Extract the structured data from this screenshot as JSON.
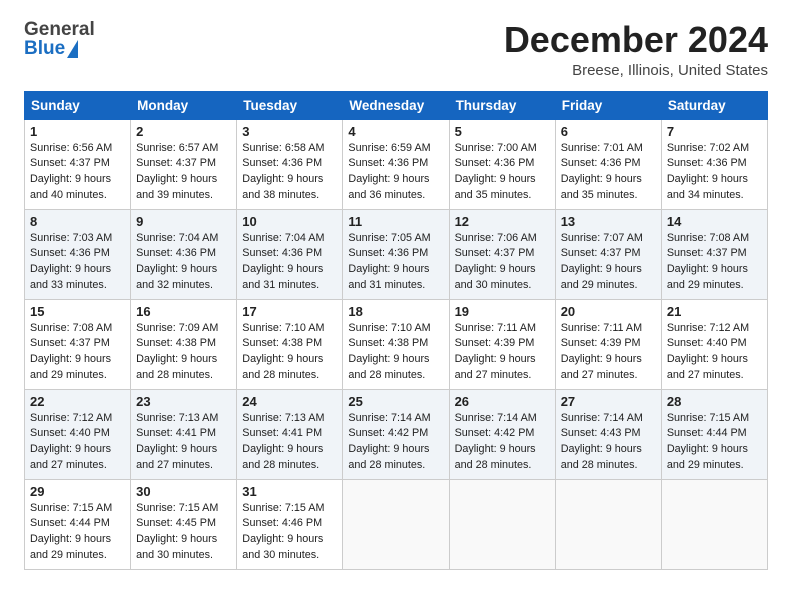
{
  "header": {
    "logo_general": "General",
    "logo_blue": "Blue",
    "month": "December 2024",
    "location": "Breese, Illinois, United States"
  },
  "weekdays": [
    "Sunday",
    "Monday",
    "Tuesday",
    "Wednesday",
    "Thursday",
    "Friday",
    "Saturday"
  ],
  "weeks": [
    [
      {
        "day": "1",
        "sunrise": "Sunrise: 6:56 AM",
        "sunset": "Sunset: 4:37 PM",
        "daylight": "Daylight: 9 hours and 40 minutes."
      },
      {
        "day": "2",
        "sunrise": "Sunrise: 6:57 AM",
        "sunset": "Sunset: 4:37 PM",
        "daylight": "Daylight: 9 hours and 39 minutes."
      },
      {
        "day": "3",
        "sunrise": "Sunrise: 6:58 AM",
        "sunset": "Sunset: 4:36 PM",
        "daylight": "Daylight: 9 hours and 38 minutes."
      },
      {
        "day": "4",
        "sunrise": "Sunrise: 6:59 AM",
        "sunset": "Sunset: 4:36 PM",
        "daylight": "Daylight: 9 hours and 36 minutes."
      },
      {
        "day": "5",
        "sunrise": "Sunrise: 7:00 AM",
        "sunset": "Sunset: 4:36 PM",
        "daylight": "Daylight: 9 hours and 35 minutes."
      },
      {
        "day": "6",
        "sunrise": "Sunrise: 7:01 AM",
        "sunset": "Sunset: 4:36 PM",
        "daylight": "Daylight: 9 hours and 35 minutes."
      },
      {
        "day": "7",
        "sunrise": "Sunrise: 7:02 AM",
        "sunset": "Sunset: 4:36 PM",
        "daylight": "Daylight: 9 hours and 34 minutes."
      }
    ],
    [
      {
        "day": "8",
        "sunrise": "Sunrise: 7:03 AM",
        "sunset": "Sunset: 4:36 PM",
        "daylight": "Daylight: 9 hours and 33 minutes."
      },
      {
        "day": "9",
        "sunrise": "Sunrise: 7:04 AM",
        "sunset": "Sunset: 4:36 PM",
        "daylight": "Daylight: 9 hours and 32 minutes."
      },
      {
        "day": "10",
        "sunrise": "Sunrise: 7:04 AM",
        "sunset": "Sunset: 4:36 PM",
        "daylight": "Daylight: 9 hours and 31 minutes."
      },
      {
        "day": "11",
        "sunrise": "Sunrise: 7:05 AM",
        "sunset": "Sunset: 4:36 PM",
        "daylight": "Daylight: 9 hours and 31 minutes."
      },
      {
        "day": "12",
        "sunrise": "Sunrise: 7:06 AM",
        "sunset": "Sunset: 4:37 PM",
        "daylight": "Daylight: 9 hours and 30 minutes."
      },
      {
        "day": "13",
        "sunrise": "Sunrise: 7:07 AM",
        "sunset": "Sunset: 4:37 PM",
        "daylight": "Daylight: 9 hours and 29 minutes."
      },
      {
        "day": "14",
        "sunrise": "Sunrise: 7:08 AM",
        "sunset": "Sunset: 4:37 PM",
        "daylight": "Daylight: 9 hours and 29 minutes."
      }
    ],
    [
      {
        "day": "15",
        "sunrise": "Sunrise: 7:08 AM",
        "sunset": "Sunset: 4:37 PM",
        "daylight": "Daylight: 9 hours and 29 minutes."
      },
      {
        "day": "16",
        "sunrise": "Sunrise: 7:09 AM",
        "sunset": "Sunset: 4:38 PM",
        "daylight": "Daylight: 9 hours and 28 minutes."
      },
      {
        "day": "17",
        "sunrise": "Sunrise: 7:10 AM",
        "sunset": "Sunset: 4:38 PM",
        "daylight": "Daylight: 9 hours and 28 minutes."
      },
      {
        "day": "18",
        "sunrise": "Sunrise: 7:10 AM",
        "sunset": "Sunset: 4:38 PM",
        "daylight": "Daylight: 9 hours and 28 minutes."
      },
      {
        "day": "19",
        "sunrise": "Sunrise: 7:11 AM",
        "sunset": "Sunset: 4:39 PM",
        "daylight": "Daylight: 9 hours and 27 minutes."
      },
      {
        "day": "20",
        "sunrise": "Sunrise: 7:11 AM",
        "sunset": "Sunset: 4:39 PM",
        "daylight": "Daylight: 9 hours and 27 minutes."
      },
      {
        "day": "21",
        "sunrise": "Sunrise: 7:12 AM",
        "sunset": "Sunset: 4:40 PM",
        "daylight": "Daylight: 9 hours and 27 minutes."
      }
    ],
    [
      {
        "day": "22",
        "sunrise": "Sunrise: 7:12 AM",
        "sunset": "Sunset: 4:40 PM",
        "daylight": "Daylight: 9 hours and 27 minutes."
      },
      {
        "day": "23",
        "sunrise": "Sunrise: 7:13 AM",
        "sunset": "Sunset: 4:41 PM",
        "daylight": "Daylight: 9 hours and 27 minutes."
      },
      {
        "day": "24",
        "sunrise": "Sunrise: 7:13 AM",
        "sunset": "Sunset: 4:41 PM",
        "daylight": "Daylight: 9 hours and 28 minutes."
      },
      {
        "day": "25",
        "sunrise": "Sunrise: 7:14 AM",
        "sunset": "Sunset: 4:42 PM",
        "daylight": "Daylight: 9 hours and 28 minutes."
      },
      {
        "day": "26",
        "sunrise": "Sunrise: 7:14 AM",
        "sunset": "Sunset: 4:42 PM",
        "daylight": "Daylight: 9 hours and 28 minutes."
      },
      {
        "day": "27",
        "sunrise": "Sunrise: 7:14 AM",
        "sunset": "Sunset: 4:43 PM",
        "daylight": "Daylight: 9 hours and 28 minutes."
      },
      {
        "day": "28",
        "sunrise": "Sunrise: 7:15 AM",
        "sunset": "Sunset: 4:44 PM",
        "daylight": "Daylight: 9 hours and 29 minutes."
      }
    ],
    [
      {
        "day": "29",
        "sunrise": "Sunrise: 7:15 AM",
        "sunset": "Sunset: 4:44 PM",
        "daylight": "Daylight: 9 hours and 29 minutes."
      },
      {
        "day": "30",
        "sunrise": "Sunrise: 7:15 AM",
        "sunset": "Sunset: 4:45 PM",
        "daylight": "Daylight: 9 hours and 30 minutes."
      },
      {
        "day": "31",
        "sunrise": "Sunrise: 7:15 AM",
        "sunset": "Sunset: 4:46 PM",
        "daylight": "Daylight: 9 hours and 30 minutes."
      },
      null,
      null,
      null,
      null
    ]
  ]
}
